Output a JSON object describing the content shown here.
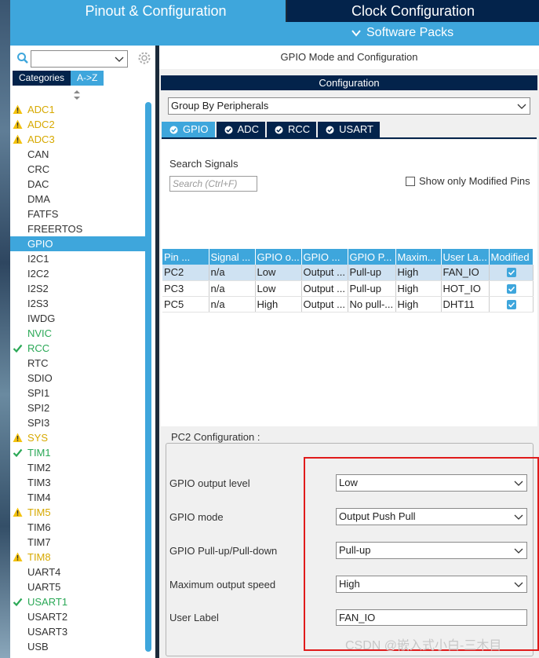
{
  "top_tabs": {
    "pinout": "Pinout & Configuration",
    "clock": "Clock Configuration",
    "software_packs": "Software Packs"
  },
  "left_panel": {
    "category_tabs": [
      "Categories",
      "A->Z"
    ],
    "peripherals": [
      {
        "name": "ADC1",
        "status": "warn"
      },
      {
        "name": "ADC2",
        "status": "warn"
      },
      {
        "name": "ADC3",
        "status": "warn"
      },
      {
        "name": "CAN",
        "status": ""
      },
      {
        "name": "CRC",
        "status": ""
      },
      {
        "name": "DAC",
        "status": ""
      },
      {
        "name": "DMA",
        "status": ""
      },
      {
        "name": "FATFS",
        "status": ""
      },
      {
        "name": "FREERTOS",
        "status": ""
      },
      {
        "name": "GPIO",
        "status": "selected"
      },
      {
        "name": "I2C1",
        "status": ""
      },
      {
        "name": "I2C2",
        "status": ""
      },
      {
        "name": "I2S2",
        "status": ""
      },
      {
        "name": "I2S3",
        "status": ""
      },
      {
        "name": "IWDG",
        "status": ""
      },
      {
        "name": "NVIC",
        "status": "ok-text"
      },
      {
        "name": "RCC",
        "status": "ok"
      },
      {
        "name": "RTC",
        "status": ""
      },
      {
        "name": "SDIO",
        "status": ""
      },
      {
        "name": "SPI1",
        "status": ""
      },
      {
        "name": "SPI2",
        "status": ""
      },
      {
        "name": "SPI3",
        "status": ""
      },
      {
        "name": "SYS",
        "status": "warn"
      },
      {
        "name": "TIM1",
        "status": "ok"
      },
      {
        "name": "TIM2",
        "status": ""
      },
      {
        "name": "TIM3",
        "status": ""
      },
      {
        "name": "TIM4",
        "status": ""
      },
      {
        "name": "TIM5",
        "status": "warn"
      },
      {
        "name": "TIM6",
        "status": ""
      },
      {
        "name": "TIM7",
        "status": ""
      },
      {
        "name": "TIM8",
        "status": "warn"
      },
      {
        "name": "UART4",
        "status": ""
      },
      {
        "name": "UART5",
        "status": ""
      },
      {
        "name": "USART1",
        "status": "ok"
      },
      {
        "name": "USART2",
        "status": ""
      },
      {
        "name": "USART3",
        "status": ""
      },
      {
        "name": "USB",
        "status": ""
      }
    ]
  },
  "right_panel": {
    "mode_title": "GPIO Mode and Configuration",
    "config_title": "Configuration",
    "group_by": "Group By Peripherals",
    "mode_tabs": [
      "GPIO",
      "ADC",
      "RCC",
      "USART"
    ],
    "search_label": "Search Signals",
    "search_placeholder": "Search (Ctrl+F)",
    "show_modified": "Show only Modified Pins",
    "table": {
      "headers": [
        "Pin ...",
        "Signal ...",
        "GPIO o...",
        "GPIO ...",
        "GPIO P...",
        "Maxim...",
        "User La...",
        "Modified"
      ],
      "rows": [
        [
          "PC2",
          "n/a",
          "Low",
          "Output ...",
          "Pull-up",
          "High",
          "FAN_IO"
        ],
        [
          "PC3",
          "n/a",
          "Low",
          "Output ...",
          "Pull-up",
          "High",
          "HOT_IO"
        ],
        [
          "PC5",
          "n/a",
          "High",
          "Output ...",
          "No pull-...",
          "High",
          "DHT11"
        ]
      ]
    },
    "pc2": {
      "legend": "PC2 Configuration :",
      "output_level_label": "GPIO output level",
      "output_level": "Low",
      "mode_label": "GPIO mode",
      "mode": "Output Push Pull",
      "pull_label": "GPIO Pull-up/Pull-down",
      "pull": "Pull-up",
      "speed_label": "Maximum output speed",
      "speed": "High",
      "user_label_label": "User Label",
      "user_label": "FAN_IO"
    }
  },
  "watermark": "CSDN @嵌入式小白-三木目",
  "colors": {
    "accent": "#3ea6dc",
    "navy": "#03234b",
    "warn": "#d7a900",
    "ok": "#2aa856"
  }
}
